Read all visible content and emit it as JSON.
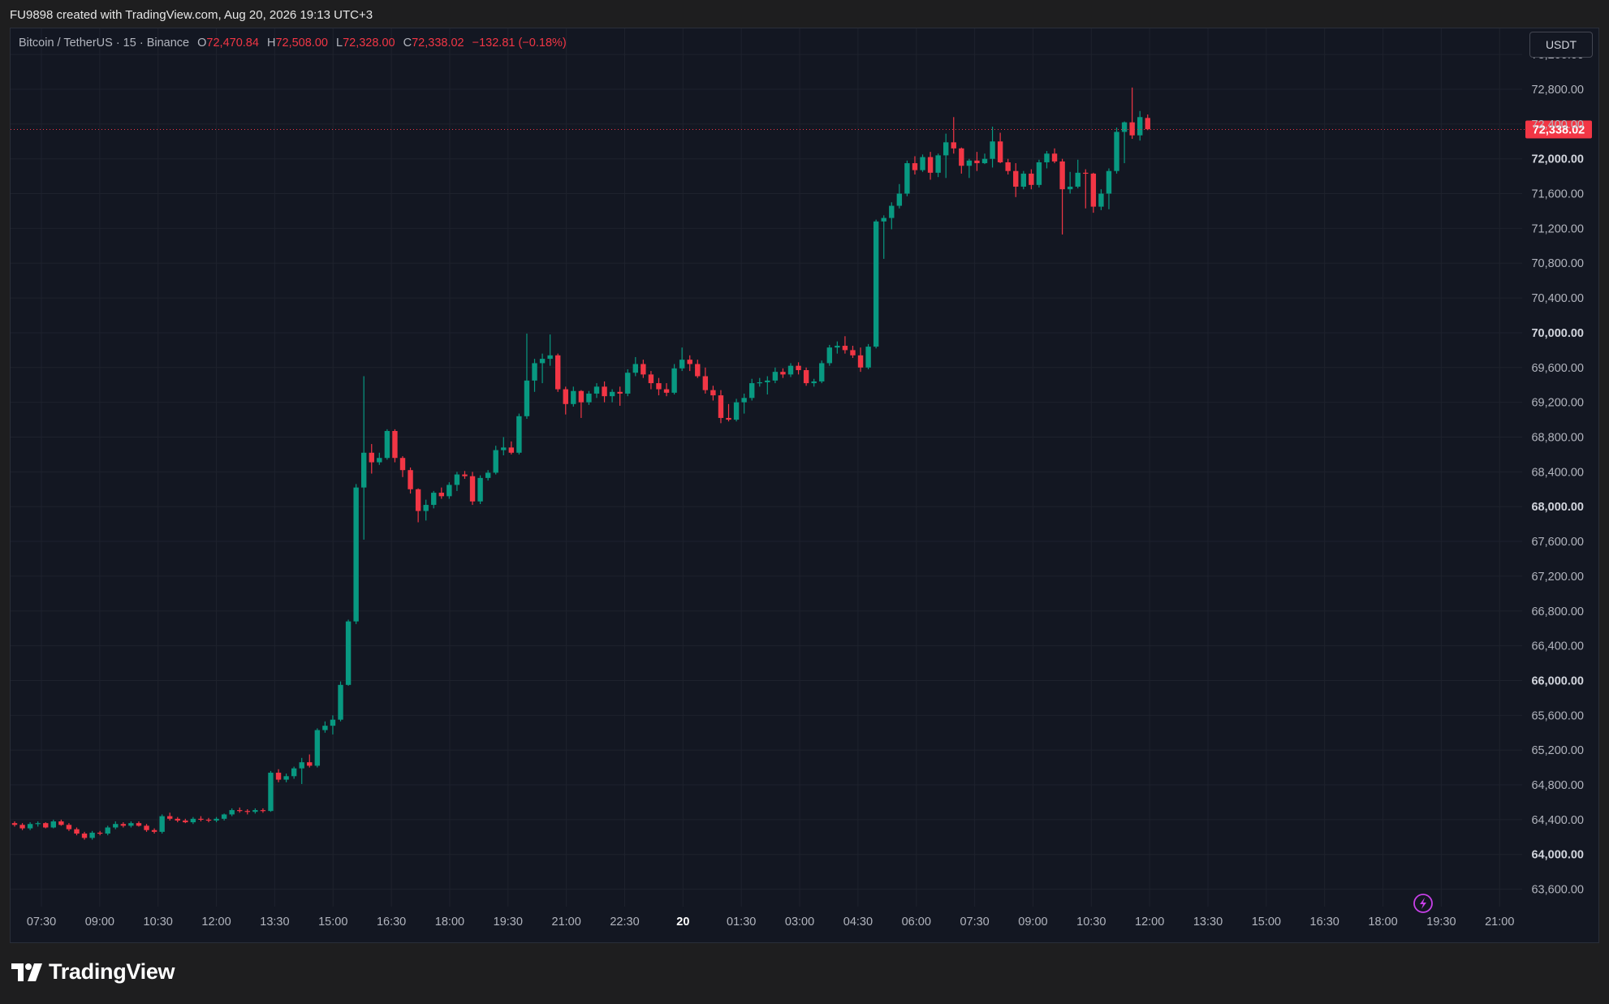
{
  "header": {
    "caption": "FU9898 created with TradingView.com, Aug 20, 2026 19:13 UTC+3"
  },
  "legend": {
    "symbol": "Bitcoin / TetherUS · 15 · Binance",
    "open_label": "O",
    "open": "72,470.84",
    "high_label": "H",
    "high": "72,508.00",
    "low_label": "L",
    "low": "72,328.00",
    "close_label": "C",
    "close": "72,338.02",
    "change": "−132.81 (−0.18%)"
  },
  "currency_button": "USDT",
  "brand": {
    "name": "TradingView"
  },
  "colors": {
    "up": "#089981",
    "down": "#f23645",
    "background": "#131722",
    "grid": "#1e222d",
    "axis_text": "#b2b5be"
  },
  "icons": {
    "lightning": "lightning-bolt-icon",
    "logo": "tradingview-logo-icon"
  },
  "chart_data": {
    "type": "candlestick",
    "interval_minutes": 15,
    "y_ticks": [
      63600,
      64000,
      64400,
      64800,
      65200,
      65600,
      66000,
      66400,
      66800,
      67200,
      67600,
      68000,
      68400,
      68800,
      69200,
      69600,
      70000,
      70400,
      70800,
      71200,
      71600,
      72000,
      72400,
      72800,
      73200
    ],
    "y_tick_labels": [
      "63,600.00",
      "64,000.00",
      "64,400.00",
      "64,800.00",
      "65,200.00",
      "65,600.00",
      "66,000.00",
      "66,400.00",
      "66,800.00",
      "67,200.00",
      "67,600.00",
      "68,000.00",
      "68,400.00",
      "68,800.00",
      "69,200.00",
      "69,600.00",
      "70,000.00",
      "70,400.00",
      "70,800.00",
      "71,200.00",
      "71,600.00",
      "72,000.00",
      "72,400.00",
      "72,800.00",
      "73,200.00"
    ],
    "x_tick_labels": [
      "07:30",
      "09:00",
      "10:30",
      "12:00",
      "13:30",
      "15:00",
      "16:30",
      "18:00",
      "19:30",
      "21:00",
      "22:30",
      "20",
      "01:30",
      "03:00",
      "04:30",
      "06:00",
      "07:30",
      "09:00",
      "10:30",
      "12:00",
      "13:30",
      "15:00",
      "16:30",
      "18:00",
      "19:30",
      "21:00"
    ],
    "last_price": 72338.02,
    "last_price_label": "72,338.02",
    "ylim": [
      63400,
      73500
    ],
    "candles": [
      [
        64360,
        64380,
        64320,
        64340
      ],
      [
        64340,
        64360,
        64280,
        64300
      ],
      [
        64300,
        64370,
        64280,
        64350
      ],
      [
        64350,
        64380,
        64320,
        64360
      ],
      [
        64360,
        64370,
        64300,
        64310
      ],
      [
        64310,
        64400,
        64300,
        64380
      ],
      [
        64380,
        64400,
        64330,
        64340
      ],
      [
        64340,
        64360,
        64270,
        64290
      ],
      [
        64290,
        64310,
        64220,
        64240
      ],
      [
        64240,
        64260,
        64170,
        64190
      ],
      [
        64190,
        64270,
        64170,
        64250
      ],
      [
        64250,
        64270,
        64220,
        64240
      ],
      [
        64240,
        64330,
        64220,
        64310
      ],
      [
        64310,
        64380,
        64290,
        64350
      ],
      [
        64350,
        64370,
        64310,
        64330
      ],
      [
        64330,
        64380,
        64310,
        64360
      ],
      [
        64360,
        64380,
        64320,
        64330
      ],
      [
        64330,
        64350,
        64260,
        64280
      ],
      [
        64280,
        64300,
        64240,
        64260
      ],
      [
        64260,
        64460,
        64240,
        64440
      ],
      [
        64440,
        64480,
        64390,
        64410
      ],
      [
        64410,
        64430,
        64370,
        64390
      ],
      [
        64390,
        64410,
        64360,
        64370
      ],
      [
        64370,
        64430,
        64350,
        64410
      ],
      [
        64410,
        64440,
        64380,
        64400
      ],
      [
        64400,
        64420,
        64370,
        64390
      ],
      [
        64390,
        64430,
        64370,
        64410
      ],
      [
        64410,
        64470,
        64390,
        64460
      ],
      [
        64460,
        64530,
        64440,
        64510
      ],
      [
        64510,
        64540,
        64480,
        64500
      ],
      [
        64500,
        64520,
        64460,
        64490
      ],
      [
        64490,
        64530,
        64470,
        64510
      ],
      [
        64510,
        64530,
        64480,
        64500
      ],
      [
        64500,
        64960,
        64490,
        64940
      ],
      [
        64940,
        64980,
        64830,
        64860
      ],
      [
        64860,
        64930,
        64830,
        64900
      ],
      [
        64900,
        65010,
        64870,
        64990
      ],
      [
        64990,
        65110,
        64810,
        65060
      ],
      [
        65060,
        65150,
        65000,
        65020
      ],
      [
        65020,
        65450,
        65000,
        65430
      ],
      [
        65430,
        65530,
        65400,
        65480
      ],
      [
        65480,
        65600,
        65380,
        65550
      ],
      [
        65550,
        65990,
        65530,
        65950
      ],
      [
        65950,
        66700,
        65940,
        66680
      ],
      [
        66680,
        68260,
        66650,
        68220
      ],
      [
        68220,
        69500,
        67620,
        68620
      ],
      [
        68620,
        68720,
        68380,
        68510
      ],
      [
        68510,
        68620,
        68480,
        68560
      ],
      [
        68560,
        68890,
        68540,
        68870
      ],
      [
        68870,
        68890,
        68510,
        68560
      ],
      [
        68560,
        68580,
        68340,
        68420
      ],
      [
        68420,
        68450,
        68150,
        68200
      ],
      [
        68200,
        68210,
        67820,
        67950
      ],
      [
        67950,
        68080,
        67840,
        68020
      ],
      [
        68020,
        68180,
        67980,
        68160
      ],
      [
        68160,
        68220,
        68090,
        68120
      ],
      [
        68120,
        68280,
        68090,
        68250
      ],
      [
        68250,
        68400,
        68180,
        68370
      ],
      [
        68370,
        68410,
        68320,
        68350
      ],
      [
        68350,
        68400,
        68020,
        68060
      ],
      [
        68060,
        68360,
        68030,
        68330
      ],
      [
        68330,
        68420,
        68300,
        68390
      ],
      [
        68390,
        68700,
        68370,
        68650
      ],
      [
        68650,
        68800,
        68590,
        68680
      ],
      [
        68680,
        68750,
        68600,
        68620
      ],
      [
        68620,
        69070,
        68600,
        69040
      ],
      [
        69040,
        69990,
        69010,
        69450
      ],
      [
        69450,
        69700,
        69320,
        69650
      ],
      [
        69650,
        69760,
        69420,
        69700
      ],
      [
        69700,
        69980,
        69620,
        69740
      ],
      [
        69740,
        69760,
        69320,
        69350
      ],
      [
        69350,
        69380,
        69060,
        69180
      ],
      [
        69180,
        69380,
        69150,
        69330
      ],
      [
        69330,
        69340,
        69020,
        69200
      ],
      [
        69200,
        69330,
        69170,
        69300
      ],
      [
        69300,
        69420,
        69250,
        69380
      ],
      [
        69380,
        69440,
        69200,
        69270
      ],
      [
        69270,
        69350,
        69200,
        69320
      ],
      [
        69320,
        69380,
        69160,
        69300
      ],
      [
        69300,
        69580,
        69270,
        69540
      ],
      [
        69540,
        69720,
        69500,
        69640
      ],
      [
        69640,
        69690,
        69480,
        69520
      ],
      [
        69520,
        69560,
        69350,
        69420
      ],
      [
        69420,
        69480,
        69280,
        69350
      ],
      [
        69350,
        69420,
        69270,
        69310
      ],
      [
        69310,
        69640,
        69290,
        69590
      ],
      [
        69590,
        69830,
        69560,
        69690
      ],
      [
        69690,
        69740,
        69560,
        69640
      ],
      [
        69640,
        69690,
        69480,
        69500
      ],
      [
        69500,
        69600,
        69300,
        69340
      ],
      [
        69340,
        69390,
        69220,
        69280
      ],
      [
        69280,
        69340,
        68960,
        69020
      ],
      [
        69020,
        69180,
        68980,
        69000
      ],
      [
        69000,
        69240,
        68980,
        69200
      ],
      [
        69200,
        69300,
        69070,
        69250
      ],
      [
        69250,
        69470,
        69220,
        69420
      ],
      [
        69420,
        69480,
        69380,
        69430
      ],
      [
        69430,
        69500,
        69290,
        69450
      ],
      [
        69450,
        69600,
        69420,
        69550
      ],
      [
        69550,
        69590,
        69480,
        69520
      ],
      [
        69520,
        69650,
        69490,
        69620
      ],
      [
        69620,
        69660,
        69520,
        69570
      ],
      [
        69570,
        69600,
        69390,
        69420
      ],
      [
        69420,
        69470,
        69380,
        69440
      ],
      [
        69440,
        69680,
        69420,
        69650
      ],
      [
        69650,
        69860,
        69620,
        69830
      ],
      [
        69830,
        69900,
        69760,
        69850
      ],
      [
        69850,
        69960,
        69760,
        69800
      ],
      [
        69800,
        69850,
        69710,
        69740
      ],
      [
        69740,
        69830,
        69550,
        69600
      ],
      [
        69600,
        69870,
        69580,
        69840
      ],
      [
        69840,
        71300,
        69820,
        71280
      ],
      [
        71280,
        71350,
        70850,
        71320
      ],
      [
        71320,
        71500,
        71190,
        71460
      ],
      [
        71460,
        71710,
        71430,
        71600
      ],
      [
        71600,
        71980,
        71570,
        71950
      ],
      [
        71950,
        72030,
        71820,
        71870
      ],
      [
        71870,
        72050,
        71850,
        72020
      ],
      [
        72020,
        72080,
        71760,
        71840
      ],
      [
        71840,
        72060,
        71790,
        72040
      ],
      [
        72040,
        72290,
        71780,
        72190
      ],
      [
        72190,
        72480,
        72060,
        72120
      ],
      [
        72120,
        72130,
        71830,
        71920
      ],
      [
        71920,
        72000,
        71780,
        71980
      ],
      [
        71980,
        72080,
        71860,
        71950
      ],
      [
        71950,
        72060,
        71940,
        72000
      ],
      [
        72000,
        72370,
        71900,
        72200
      ],
      [
        72200,
        72300,
        71950,
        71960
      ],
      [
        71960,
        72000,
        71820,
        71860
      ],
      [
        71860,
        71950,
        71560,
        71680
      ],
      [
        71680,
        71860,
        71650,
        71830
      ],
      [
        71830,
        71880,
        71650,
        71700
      ],
      [
        71700,
        71990,
        71670,
        71960
      ],
      [
        71960,
        72090,
        71890,
        72060
      ],
      [
        72060,
        72120,
        71950,
        71970
      ],
      [
        71970,
        72000,
        71130,
        71650
      ],
      [
        71650,
        71850,
        71600,
        71680
      ],
      [
        71680,
        71990,
        71660,
        71840
      ],
      [
        71840,
        71880,
        71430,
        71830
      ],
      [
        71830,
        71840,
        71380,
        71450
      ],
      [
        71450,
        71650,
        71410,
        71600
      ],
      [
        71600,
        71890,
        71420,
        71860
      ],
      [
        71860,
        72360,
        71830,
        72310
      ],
      [
        72310,
        72430,
        71950,
        72420
      ],
      [
        72420,
        72820,
        72230,
        72270
      ],
      [
        72270,
        72550,
        72210,
        72480
      ],
      [
        72470,
        72510,
        72330,
        72340
      ]
    ]
  }
}
